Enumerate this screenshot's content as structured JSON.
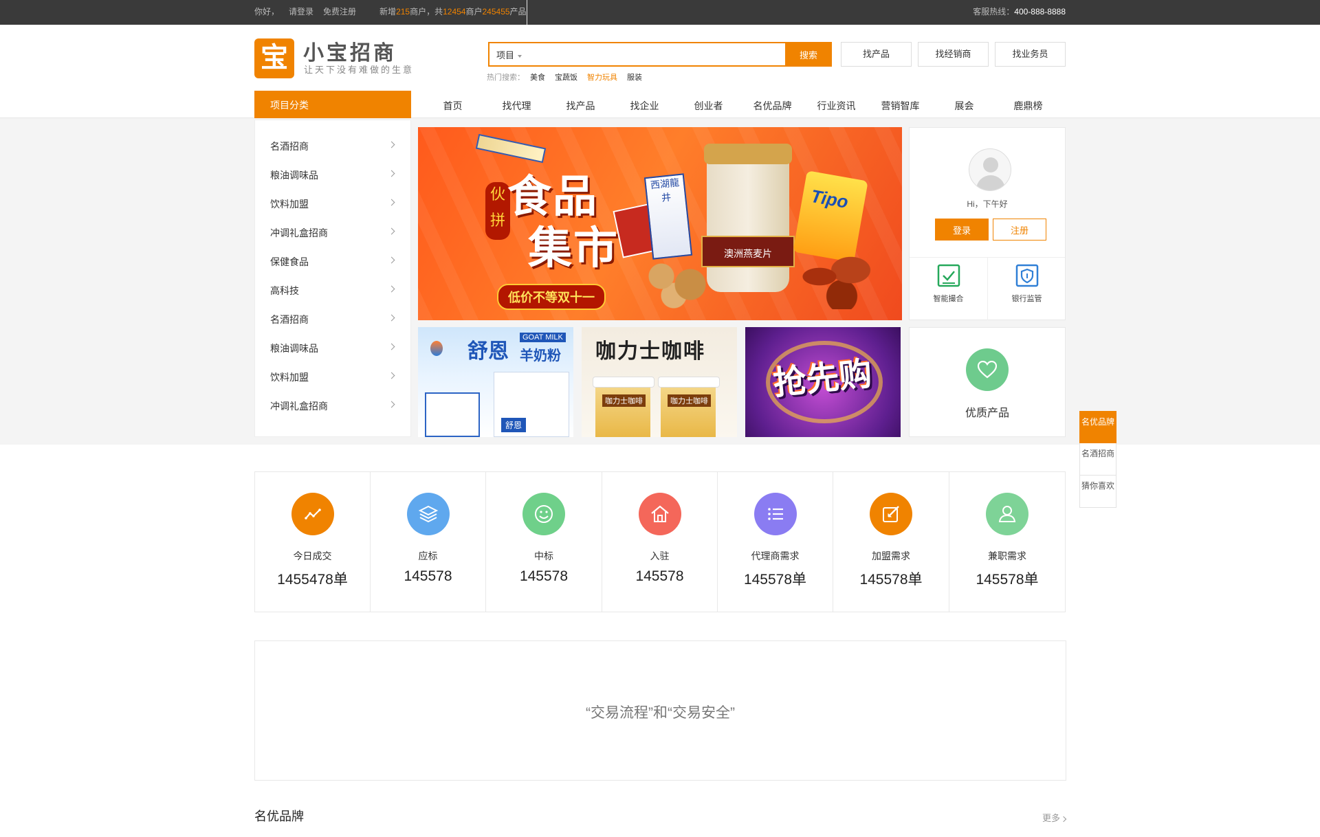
{
  "topbar": {
    "greeting": "你好，",
    "login": "请登录",
    "register": "免费注册",
    "stats_pre": "新增",
    "new_count": "215",
    "stats_mid": "商户，共",
    "merchant_total": "12454",
    "stats_mid2": "商户",
    "product_total": "245455",
    "stats_post": "产品",
    "hotline_label": "客服热线：",
    "hotline": "400-888-8888"
  },
  "header": {
    "logo_char": "宝",
    "logo_name": "小宝招商",
    "slogan": "让天下没有难做的生意",
    "search": {
      "category": "项目",
      "placeholder": "",
      "button": "搜索"
    },
    "buttons": [
      "找产品",
      "找经销商",
      "找业务员"
    ],
    "hot_label": "热门搜索：",
    "hot_terms": [
      "美食",
      "宝蔬饭",
      "智力玩具",
      "服装"
    ],
    "hot_active_index": 2,
    "category_head": "项目分类",
    "nav": [
      "首页",
      "找代理",
      "找产品",
      "找企业",
      "创业者",
      "名优品牌",
      "行业资讯",
      "营销智库",
      "展会",
      "鹿鼎榜"
    ]
  },
  "categories": [
    "名酒招商",
    "粮油调味品",
    "饮料加盟",
    "冲调礼盒招商",
    "保健食品",
    "高科技",
    "名酒招商",
    "粮油调味品",
    "饮料加盟",
    "冲调礼盒招商"
  ],
  "banner": {
    "title_line1": "食品",
    "title_line2": "集市",
    "seal": "伙拼",
    "ribbon": "低价不等双十一",
    "jar_label": "澳洲燕麦片",
    "pack_label": "西湖龍井",
    "chips_label": "Tipo"
  },
  "user": {
    "greeting": "Hi，下午好",
    "login": "登录",
    "register": "注册",
    "features": [
      "智能撮合",
      "银行监管"
    ]
  },
  "promos": {
    "p1_title": "舒恩",
    "p1_tag": "GOAT MILK",
    "p1_sub": "羊奶粉",
    "p1_bag": "舒恩",
    "p2_title": "咖力士咖啡",
    "p2_cup": "咖力士咖啡",
    "p3_title": "抢先购"
  },
  "quality": {
    "label": "优质产品",
    "color": "#6ecb8d"
  },
  "side_float": [
    "名优品牌",
    "名酒招商",
    "猜你喜欢"
  ],
  "stats": [
    {
      "label": "今日成交",
      "value": "1455478单",
      "color": "#f08300",
      "icon": "trend-icon"
    },
    {
      "label": "应标",
      "value": "145578",
      "color": "#5fa8ee",
      "icon": "layers-icon"
    },
    {
      "label": "中标",
      "value": "145578",
      "color": "#6fd08a",
      "icon": "smile-icon"
    },
    {
      "label": "入驻",
      "value": "145578",
      "color": "#f4675a",
      "icon": "home-icon"
    },
    {
      "label": "代理商需求",
      "value": "145578单",
      "color": "#8a7cf2",
      "icon": "list-icon"
    },
    {
      "label": "加盟需求",
      "value": "145578单",
      "color": "#f08300",
      "icon": "edit-icon"
    },
    {
      "label": "兼职需求",
      "value": "145578单",
      "color": "#7ed397",
      "icon": "user-icon"
    }
  ],
  "flow_text": "“交易流程”和“交易安全”",
  "brand_section": {
    "title": "名优品牌",
    "more": "更多"
  },
  "colors": {
    "accent": "#f08300",
    "topbar": "#3a3a3a"
  }
}
